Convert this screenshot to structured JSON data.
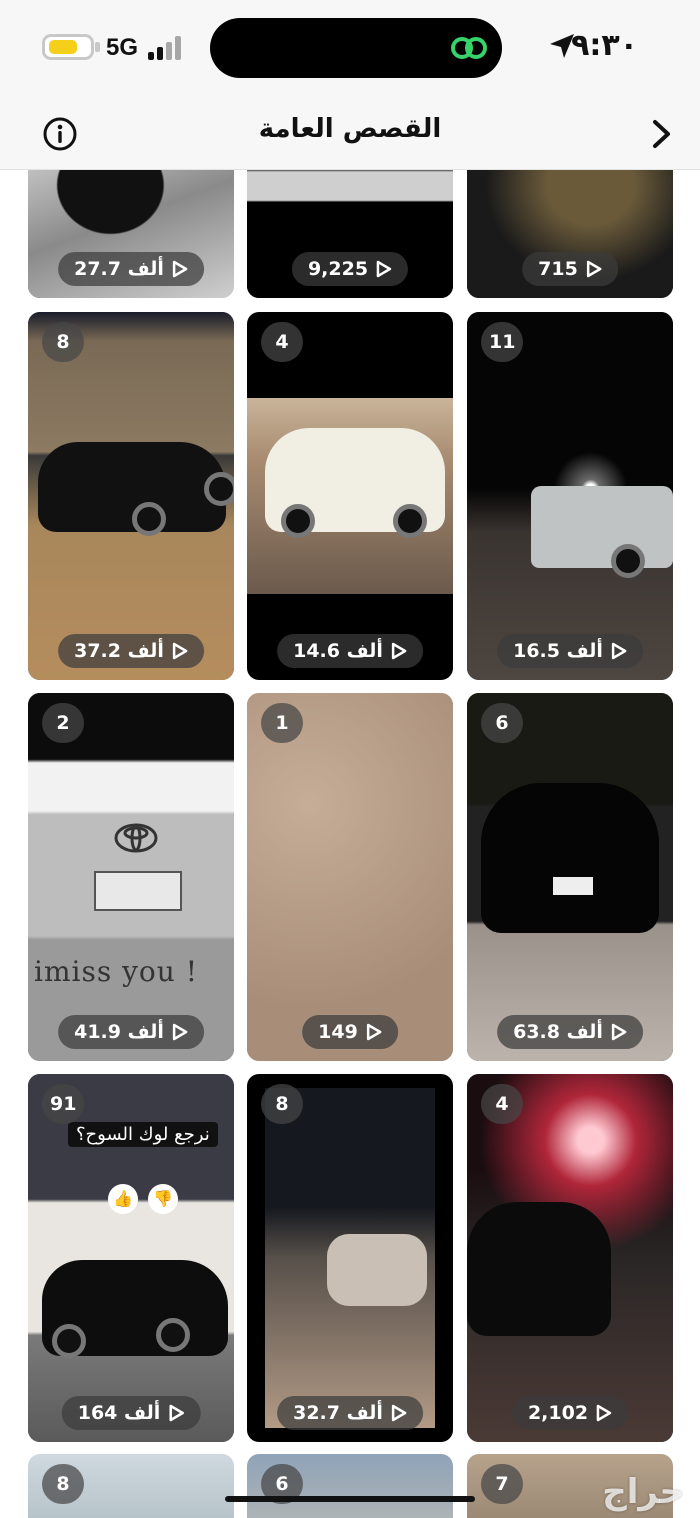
{
  "status_bar": {
    "time": "٩:٣٠",
    "network": "5G",
    "battery_level": 0.7,
    "battery_color": "#f6cf1a"
  },
  "header": {
    "title": "القصص العامة",
    "left_icon": "info-icon",
    "right_icon": "chevron-right-icon"
  },
  "tiles": [
    {
      "count": "",
      "views": "27.7 ألف"
    },
    {
      "count": "",
      "views": "9,225"
    },
    {
      "count": "",
      "views": "715"
    },
    {
      "count": "8",
      "views": "37.2 ألف"
    },
    {
      "count": "4",
      "views": "14.6 ألف"
    },
    {
      "count": "11",
      "views": "16.5 ألف"
    },
    {
      "count": "2",
      "views": "41.9 ألف"
    },
    {
      "count": "1",
      "views": "149"
    },
    {
      "count": "6",
      "views": "63.8 ألف"
    },
    {
      "count": "91",
      "views": "164 ألف",
      "overlay_text": "نرجع لوك السوح؟"
    },
    {
      "count": "8",
      "views": "32.7 ألف"
    },
    {
      "count": "4",
      "views": "2,102"
    },
    {
      "count": "8",
      "views": ""
    },
    {
      "count": "6",
      "views": ""
    },
    {
      "count": "7",
      "views": ""
    }
  ],
  "plate_text": "imiss you !",
  "watermark": "حراج"
}
